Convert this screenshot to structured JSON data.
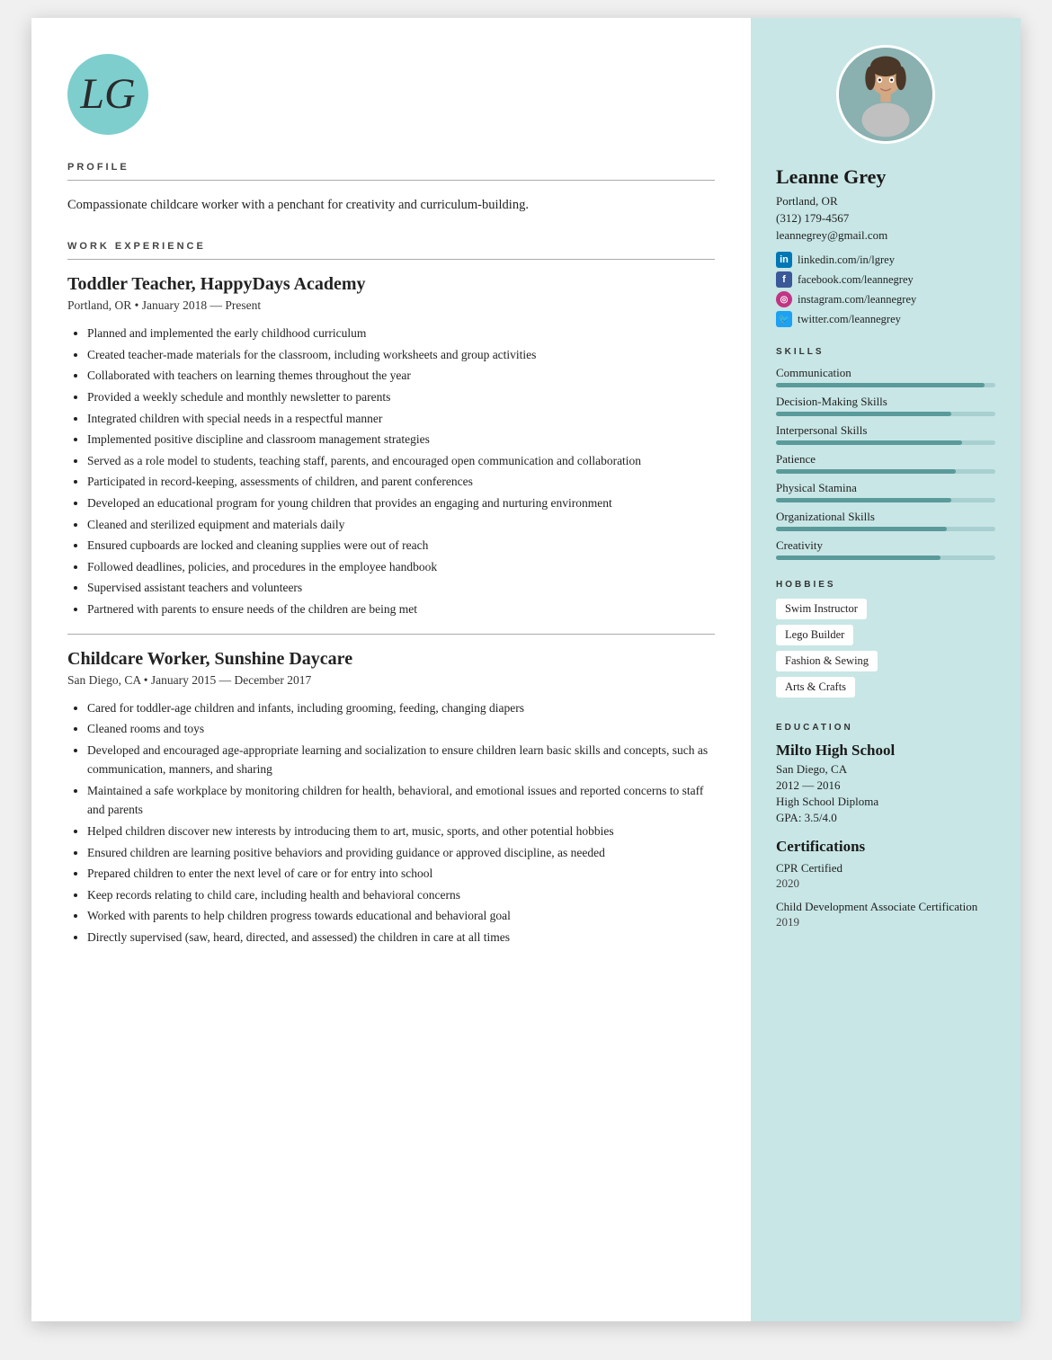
{
  "logo": {
    "initials": "LG"
  },
  "left": {
    "profile_section": "PROFILE",
    "profile_text": "Compassionate childcare worker with a penchant for creativity and curriculum-building.",
    "work_section": "WORK EXPERIENCE",
    "jobs": [
      {
        "title": "Toddler Teacher, HappyDays Academy",
        "meta": "Portland, OR • January 2018 — Present",
        "bullets": [
          "Planned and implemented the early childhood curriculum",
          "Created teacher-made materials for the classroom, including worksheets and group activities",
          "Collaborated with teachers on learning themes throughout the year",
          "Provided a weekly schedule and monthly newsletter to parents",
          "Integrated children with special needs in a respectful manner",
          "Implemented positive discipline and classroom management strategies",
          "Served as a role model to students, teaching staff, parents, and encouraged open communication and collaboration",
          "Participated in record-keeping, assessments of children, and parent conferences",
          "Developed an educational program for young children that provides an engaging and nurturing environment",
          "Cleaned and sterilized equipment and materials daily",
          "Ensured cupboards are locked and cleaning supplies were out of reach",
          "Followed deadlines, policies, and procedures in the employee handbook",
          "Supervised assistant teachers and volunteers",
          "Partnered with parents to ensure needs of the children are being met"
        ]
      },
      {
        "title": "Childcare Worker, Sunshine Daycare",
        "meta": "San Diego, CA • January 2015 — December 2017",
        "bullets": [
          "Cared for toddler-age children and infants, including grooming, feeding, changing diapers",
          "Cleaned rooms and toys",
          "Developed and encouraged age-appropriate learning and socialization to ensure children learn basic skills and concepts, such as communication, manners, and sharing",
          "Maintained a safe workplace by monitoring children for health, behavioral, and emotional issues and reported concerns to staff and parents",
          "Helped children discover new interests by introducing them to art, music, sports, and other potential hobbies",
          "Ensured children are learning positive behaviors and providing guidance or approved discipline, as needed",
          "Prepared children to enter the next level of care or for entry into school",
          "Keep records relating to child care, including health and behavioral concerns",
          "Worked with parents to help children progress towards educational and behavioral goal",
          "Directly supervised (saw, heard, directed, and assessed) the children in care at all times"
        ]
      }
    ]
  },
  "right": {
    "name": "Leanne Grey",
    "city": "Portland, OR",
    "phone": "(312) 179-4567",
    "email": "leannegrey@gmail.com",
    "social": [
      {
        "icon": "in",
        "text": "linkedin.com/in/lgrey",
        "type": "linkedin"
      },
      {
        "icon": "f",
        "text": "facebook.com/leannegrey",
        "type": "facebook"
      },
      {
        "icon": "o",
        "text": "instagram.com/leannegrey",
        "type": "instagram"
      },
      {
        "icon": "b",
        "text": "twitter.com/leannegrey",
        "type": "twitter"
      }
    ],
    "skills_title": "SKILLS",
    "skills": [
      {
        "name": "Communication",
        "pct": 95
      },
      {
        "name": "Decision-Making Skills",
        "pct": 80
      },
      {
        "name": "Interpersonal Skills",
        "pct": 85
      },
      {
        "name": "Patience",
        "pct": 82
      },
      {
        "name": "Physical Stamina",
        "pct": 80
      },
      {
        "name": "Organizational Skills",
        "pct": 78
      },
      {
        "name": "Creativity",
        "pct": 75
      }
    ],
    "hobbies_title": "HOBBIES",
    "hobbies": [
      "Swim Instructor",
      "Lego Builder",
      "Fashion & Sewing",
      "Arts & Crafts"
    ],
    "education_title": "EDUCATION",
    "school_name": "Milto High School",
    "school_location": "San Diego, CA",
    "school_years": "2012 — 2016",
    "school_degree": "High School Diploma",
    "school_gpa": "GPA: 3.5/4.0",
    "certifications_title": "Certifications",
    "certifications": [
      {
        "name": "CPR Certified",
        "year": "2020"
      },
      {
        "name": "Child Development Associate Certification",
        "year": "2019"
      }
    ]
  }
}
